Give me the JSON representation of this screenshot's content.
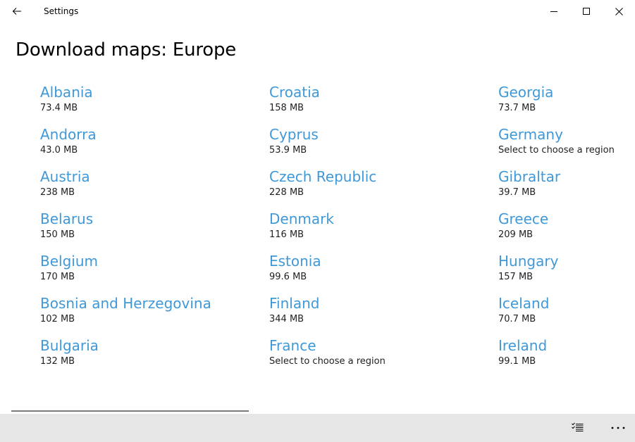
{
  "window": {
    "title": "Settings"
  },
  "page": {
    "title": "Download maps: Europe"
  },
  "countries": [
    {
      "name": "Albania",
      "detail": "73.4 MB"
    },
    {
      "name": "Andorra",
      "detail": "43.0 MB"
    },
    {
      "name": "Austria",
      "detail": "238 MB"
    },
    {
      "name": "Belarus",
      "detail": "150 MB"
    },
    {
      "name": "Belgium",
      "detail": "170 MB"
    },
    {
      "name": "Bosnia and Herzegovina",
      "detail": "102 MB"
    },
    {
      "name": "Bulgaria",
      "detail": "132 MB"
    },
    {
      "name": "Croatia",
      "detail": "158 MB"
    },
    {
      "name": "Cyprus",
      "detail": "53.9 MB"
    },
    {
      "name": "Czech Republic",
      "detail": "228 MB"
    },
    {
      "name": "Denmark",
      "detail": "116 MB"
    },
    {
      "name": "Estonia",
      "detail": "99.6 MB"
    },
    {
      "name": "Finland",
      "detail": "344 MB"
    },
    {
      "name": "France",
      "detail": "Select to choose a region"
    },
    {
      "name": "Georgia",
      "detail": "73.7 MB"
    },
    {
      "name": "Germany",
      "detail": "Select to choose a region"
    },
    {
      "name": "Gibraltar",
      "detail": "39.7 MB"
    },
    {
      "name": "Greece",
      "detail": "209 MB"
    },
    {
      "name": "Hungary",
      "detail": "157 MB"
    },
    {
      "name": "Iceland",
      "detail": "70.7 MB"
    },
    {
      "name": "Ireland",
      "detail": "99.1 MB"
    }
  ],
  "icons": {
    "back": "back-arrow-icon",
    "minimize": "minimize-icon",
    "maximize": "maximize-icon",
    "close": "close-icon",
    "select": "select-list-icon",
    "more": "more-icon"
  },
  "colors": {
    "link": "#3f98d7",
    "bottom_bar": "#e6e6e6"
  }
}
